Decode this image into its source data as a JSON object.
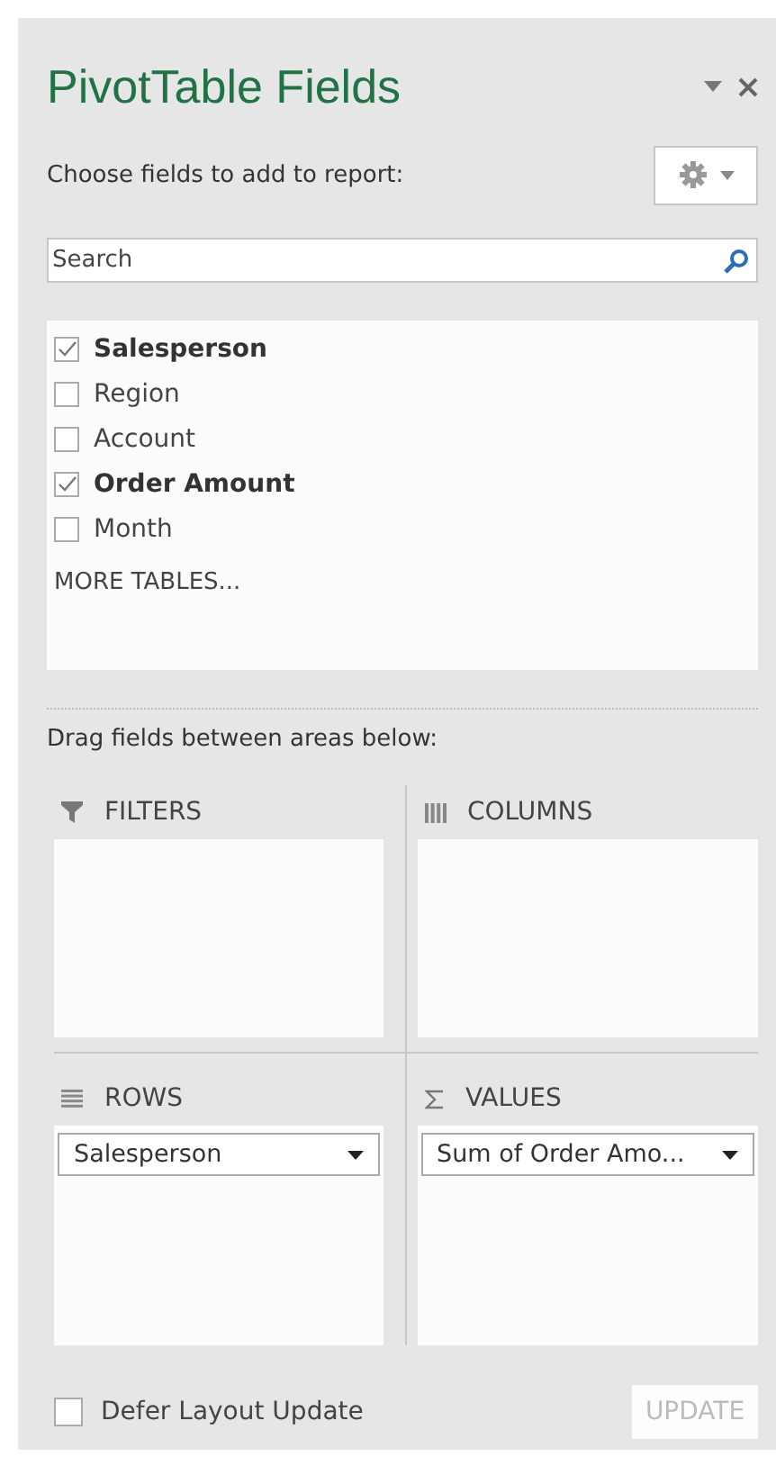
{
  "panel": {
    "title": "PivotTable Fields",
    "subtitle": "Choose fields to add to report:"
  },
  "search": {
    "placeholder": "Search"
  },
  "fields": [
    {
      "label": "Salesperson",
      "checked": true
    },
    {
      "label": "Region",
      "checked": false
    },
    {
      "label": "Account",
      "checked": false
    },
    {
      "label": "Order Amount",
      "checked": true
    },
    {
      "label": "Month",
      "checked": false
    }
  ],
  "more_tables": "MORE TABLES...",
  "areas_hint": "Drag fields between areas below:",
  "areas": [
    {
      "kind": "filters",
      "label": "FILTERS"
    },
    {
      "kind": "columns",
      "label": "COLUMNS"
    },
    {
      "kind": "rows",
      "label": "ROWS",
      "items": [
        {
          "label": "Salesperson"
        }
      ]
    },
    {
      "kind": "values",
      "label": "VALUES",
      "items": [
        {
          "label": "Sum of Order Amo..."
        }
      ]
    }
  ],
  "defer": {
    "label": "Defer Layout Update",
    "checked": false
  },
  "update_button": {
    "label": "UPDATE",
    "disabled": true
  }
}
